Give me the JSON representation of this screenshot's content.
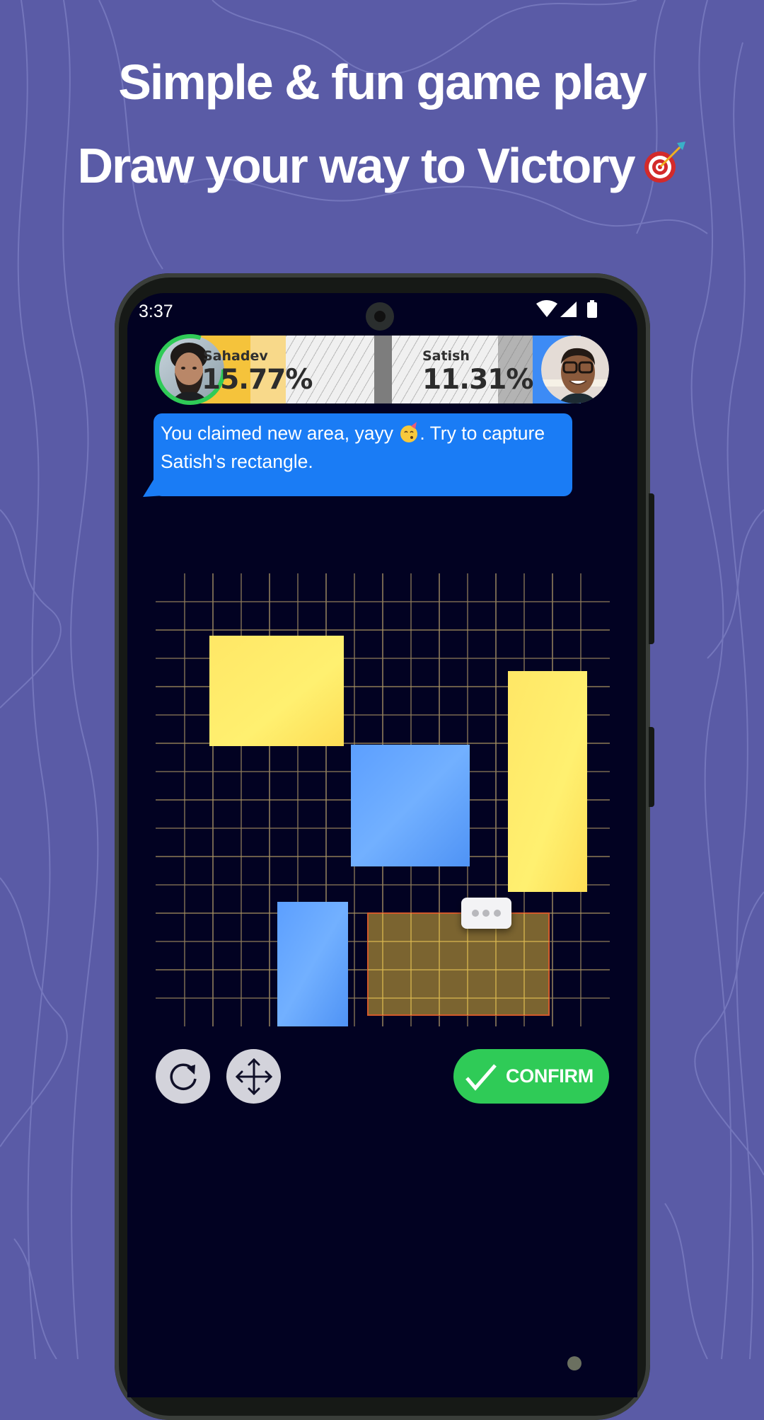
{
  "promo": {
    "headline_1": "Simple & fun game play",
    "headline_2": "Draw your way to Victory",
    "headline_2_emoji": "direct-hit-target",
    "background_color": "#5a5ba6"
  },
  "status_bar": {
    "time": "3:37",
    "icons": [
      "wifi-icon",
      "cellular-signal-icon",
      "battery-icon"
    ]
  },
  "scoreboard": {
    "player_1": {
      "name": "Sahadev",
      "percent": "15.77%",
      "color": "#f5c33b",
      "turn_ring_color": "#2fcb57"
    },
    "player_2": {
      "name": "Satish",
      "percent": "11.31%",
      "color": "#3d8bf5"
    }
  },
  "message": {
    "text_before_emoji": "You claimed new area, yayy ",
    "emoji": "partying-face",
    "text_after_emoji": ". Try to capture Satish's rectangle."
  },
  "board": {
    "grid_columns": 16,
    "grid_rows": 16,
    "rectangles": [
      {
        "owner": "player_1",
        "color": "#fde65e",
        "col": 1.9,
        "row": 2.2,
        "w": 4.75,
        "h": 3.9
      },
      {
        "owner": "player_2",
        "color": "#66a8ff",
        "col": 6.9,
        "row": 6.05,
        "w": 4.2,
        "h": 4.3
      },
      {
        "owner": "player_1",
        "color": "#fde159",
        "col": 12.45,
        "row": 3.45,
        "w": 2.8,
        "h": 7.8
      },
      {
        "owner": "player_2",
        "color": "#5ea3ff",
        "col": 4.3,
        "row": 11.6,
        "w": 2.5,
        "h": 4.4
      },
      {
        "owner": "pending",
        "color": "#7b6430",
        "border": "#d25a2b",
        "col": 7.5,
        "row": 12.0,
        "w": 6.4,
        "h": 3.6
      }
    ],
    "context_menu_label": "more-options"
  },
  "controls": {
    "refresh_label": "refresh",
    "move_label": "move",
    "confirm_label": "CONFIRM"
  }
}
